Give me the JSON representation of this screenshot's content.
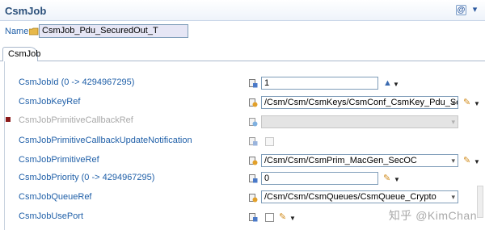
{
  "header": {
    "title": "CsmJob",
    "at_icon": "@",
    "dropdown_icon": "▾"
  },
  "name_row": {
    "label": "Name",
    "value": "CsmJob_Pdu_SecuredOut_T"
  },
  "tab": {
    "label": "CsmJob"
  },
  "params": {
    "job_id": {
      "label": "CsmJobId (0 -> 4294967295)",
      "value": "1"
    },
    "key_ref": {
      "label": "CsmJobKeyRef",
      "value": "/Csm/Csm/CsmKeys/CsmConf_CsmKey_Pdu_SecuredOut_T"
    },
    "callback_ref": {
      "label": "CsmJobPrimitiveCallbackRef",
      "value": ""
    },
    "callback_notif": {
      "label": "CsmJobPrimitiveCallbackUpdateNotification"
    },
    "primitive_ref": {
      "label": "CsmJobPrimitiveRef",
      "value": "/Csm/Csm/CsmPrim_MacGen_SecOC"
    },
    "priority": {
      "label": "CsmJobPriority (0 -> 4294967295)",
      "value": "0"
    },
    "queue_ref": {
      "label": "CsmJobQueueRef",
      "value": "/Csm/Csm/CsmQueues/CsmQueue_Crypto"
    },
    "use_port": {
      "label": "CsmJobUsePort"
    }
  },
  "icons": {
    "pencil": "✎",
    "caret": "▼",
    "chart": "▲",
    "combo": "▾"
  },
  "watermark": "知乎 @KimChan",
  "colors": {
    "label_blue": "#1f5fa8",
    "header_blue": "#2a4f7a",
    "marker_red": "#8b1a1a"
  }
}
